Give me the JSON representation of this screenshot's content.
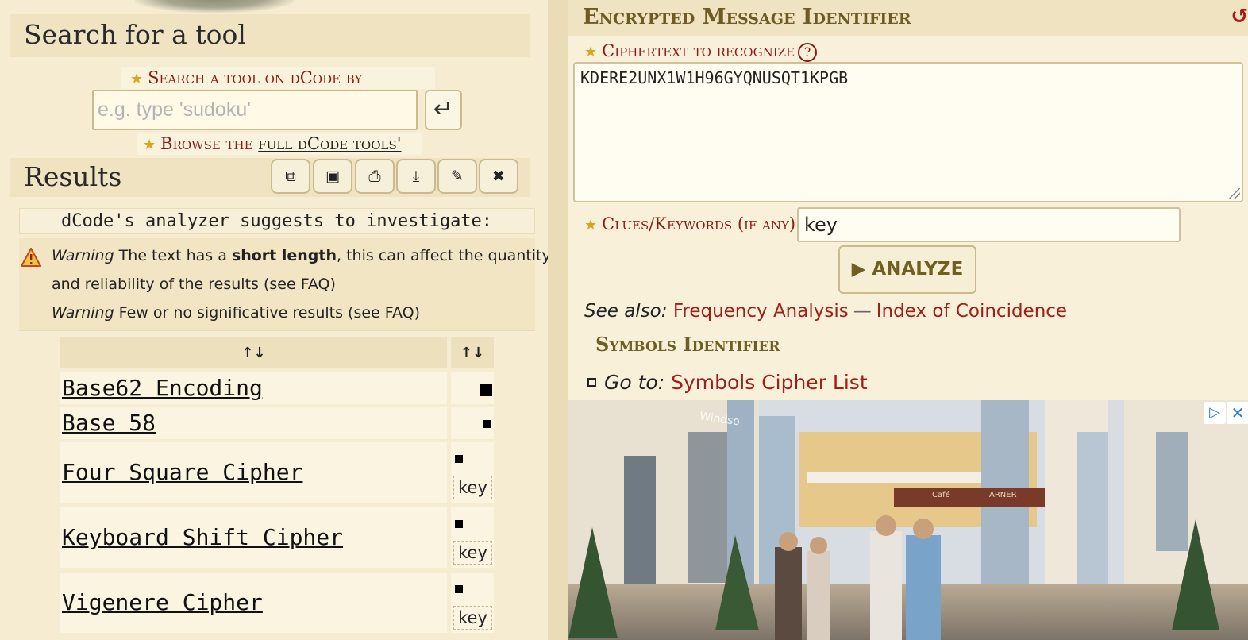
{
  "search": {
    "heading": "Search for a tool",
    "label": "Search a tool on dCode by keywords:",
    "placeholder": "e.g. type 'sudoku'",
    "go_icon": "enter-arrow-icon",
    "browse_prefix": "Browse the",
    "browse_link": "full dCode tools' list"
  },
  "results": {
    "heading": "Results",
    "toolbar": [
      {
        "name": "copy",
        "icon": "copy-icon",
        "glyph": "⧉"
      },
      {
        "name": "save",
        "icon": "save-icon",
        "glyph": "▣"
      },
      {
        "name": "print",
        "icon": "print-icon",
        "glyph": "⎙"
      },
      {
        "name": "download",
        "icon": "download-icon",
        "glyph": "⤓"
      },
      {
        "name": "pin",
        "icon": "pin-icon",
        "glyph": "✎"
      },
      {
        "name": "close",
        "icon": "close-icon",
        "glyph": "✖"
      }
    ],
    "suggest_text": "dCode's analyzer suggests to investigate:",
    "warn1_label": "Warning",
    "warn1_text_a": " The text has a ",
    "warn1_bold": "short length",
    "warn1_text_b": ", this can affect the quantity",
    "warn1_text_c": "and reliability of the results (see FAQ)",
    "warn2_label": "Warning",
    "warn2_text": " Few or no significative results (see FAQ)",
    "table": {
      "col1_header": "↑↓",
      "col2_header": "↑↓",
      "rows": [
        {
          "name": "Base62 Encoding",
          "score_level": "large",
          "key": ""
        },
        {
          "name": "Base 58",
          "score_level": "small",
          "key": ""
        },
        {
          "name": "Four Square Cipher",
          "score_level": "small",
          "key": "key"
        },
        {
          "name": "Keyboard Shift Cipher",
          "score_level": "small",
          "key": "key"
        },
        {
          "name": "Vigenere Cipher",
          "score_level": "small",
          "key": "key"
        }
      ]
    }
  },
  "emi": {
    "heading": "Encrypted Message Identifier",
    "ciphertext_label": "Ciphertext to recognize",
    "help": "?",
    "ciphertext_value": "KDERE2UNX1W1H96GYQNUSQT1KPGB",
    "clues_label": "Clues/Keywords (if any)",
    "clues_value": "key",
    "analyze_label": "ANALYZE",
    "see_also_label": "See also:",
    "see_also_links": [
      "Frequency Analysis",
      "Index of Coincidence"
    ],
    "see_also_sep": "—",
    "symbols_identifier": "Symbols Identifier",
    "goto_label": "Go to:",
    "goto_link": "Symbols Cipher List"
  },
  "ad": {
    "adchoices_icon": "adchoices-icon",
    "close_icon": "close-icon",
    "sign_text": "Windso",
    "cafe_text": "Café",
    "shop_text": "ARNER"
  },
  "colors": {
    "accent_red": "#8e1a14",
    "link_red": "#a01e18",
    "olive": "#6e6022",
    "panel": "#efe3c1"
  }
}
